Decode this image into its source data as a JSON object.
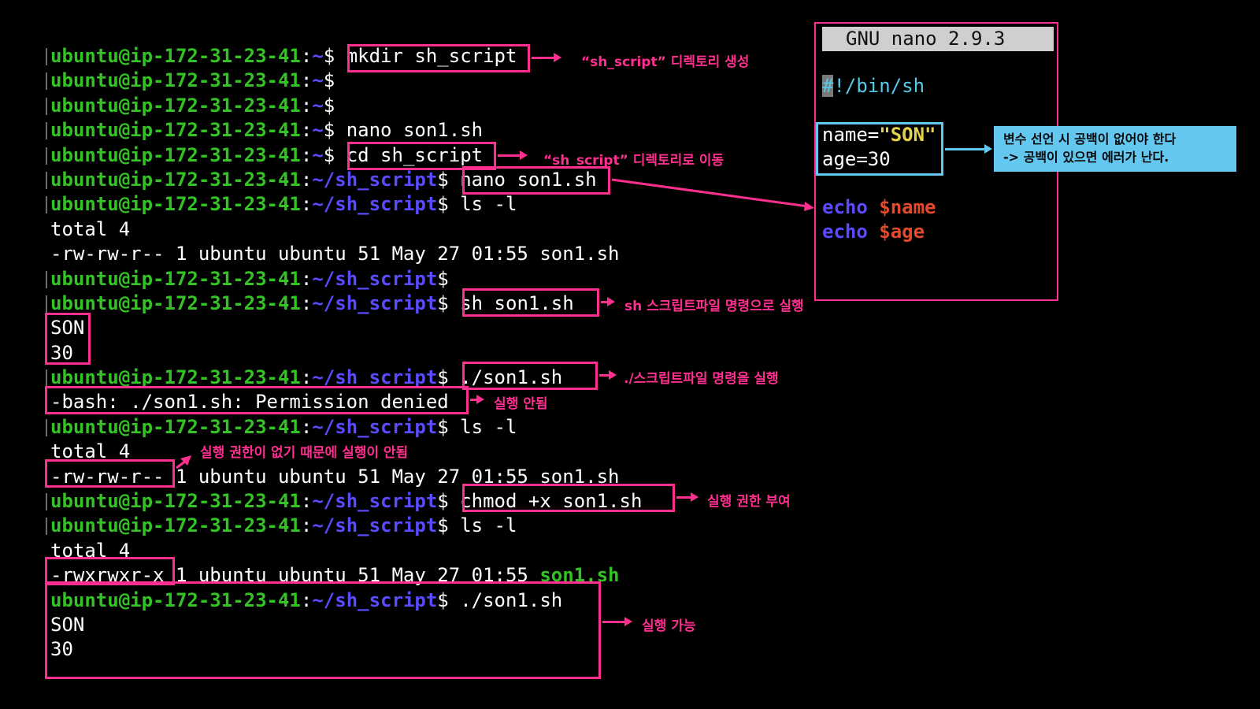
{
  "prompt": {
    "user": "ubuntu@ip-172-31-23-41",
    "colon": ":",
    "home": "~",
    "path": "~/sh_script",
    "dollar": "$"
  },
  "lines": [
    {
      "prompt": "home",
      "cmd": " mkdir sh_script"
    },
    {
      "prompt": "home",
      "cmd": ""
    },
    {
      "prompt": "home",
      "cmd": ""
    },
    {
      "prompt": "home",
      "cmd": " nano son1.sh"
    },
    {
      "prompt": "home",
      "cmd": " cd sh_script"
    },
    {
      "prompt": "path",
      "cmd": " nano son1.sh"
    },
    {
      "prompt": "path",
      "cmd": " ls -l"
    },
    {
      "out": "total 4"
    },
    {
      "out": "-rw-rw-r-- 1 ubuntu ubuntu 51 May 27 01:55 son1.sh"
    },
    {
      "prompt": "path",
      "cmd": ""
    },
    {
      "prompt": "path",
      "cmd": " sh son1.sh"
    },
    {
      "out": "SON"
    },
    {
      "out": "30"
    },
    {
      "prompt": "path",
      "cmd": " ./son1.sh"
    },
    {
      "out": "-bash: ./son1.sh: Permission denied"
    },
    {
      "prompt": "path",
      "cmd": " ls -l"
    },
    {
      "out": "total 4"
    },
    {
      "out": "-rw-rw-r-- 1 ubuntu ubuntu 51 May 27 01:55 son1.sh"
    },
    {
      "prompt": "path",
      "cmd": " chmod +x son1.sh"
    },
    {
      "prompt": "path",
      "cmd": " ls -l"
    },
    {
      "out": "total 4"
    },
    {
      "out": "-rwxrwxr-x 1 ubuntu ubuntu 51 May 27 01:55 ",
      "out_green": "son1.sh"
    },
    {
      "prompt": "path",
      "cmd": " ./son1.sh"
    },
    {
      "out": "SON"
    },
    {
      "out": "30"
    }
  ],
  "annotations": {
    "mkdir": "“sh_script” 디렉토리 생성",
    "cd": "“sh_script” 디렉토리로 이동",
    "sh_run": "sh 스크립트파일  명령으로 실행",
    "dot_run": "./스크립트파일   명령을 실행",
    "denied": "실행 안됨",
    "no_perm": "실행 권한이 없기 때문에 실행이 안됨",
    "chmod": "실행 권한 부여",
    "runnable": "실행 가능"
  },
  "nano": {
    "header": "GNU nano 2.9.3",
    "shebang_hash": "#",
    "shebang_rest": "!/bin/sh",
    "name_key": "name=",
    "name_val": "\"SON\"",
    "age_line": "age=30",
    "echo": "echo",
    "var_name": "$name",
    "var_age": "$age"
  },
  "note": {
    "line1": "변수 선언 시 공백이 없어야 한다",
    "line2": "-> 공백이 있으면 에러가 난다."
  },
  "colors": {
    "background": "#000000",
    "prompt_user": "#34c324",
    "prompt_path": "#5a4bff",
    "highlight": "#ff2f8f",
    "note_blue": "#63c7f0",
    "nano_string": "#e6d24a",
    "nano_var": "#e34a2b"
  }
}
